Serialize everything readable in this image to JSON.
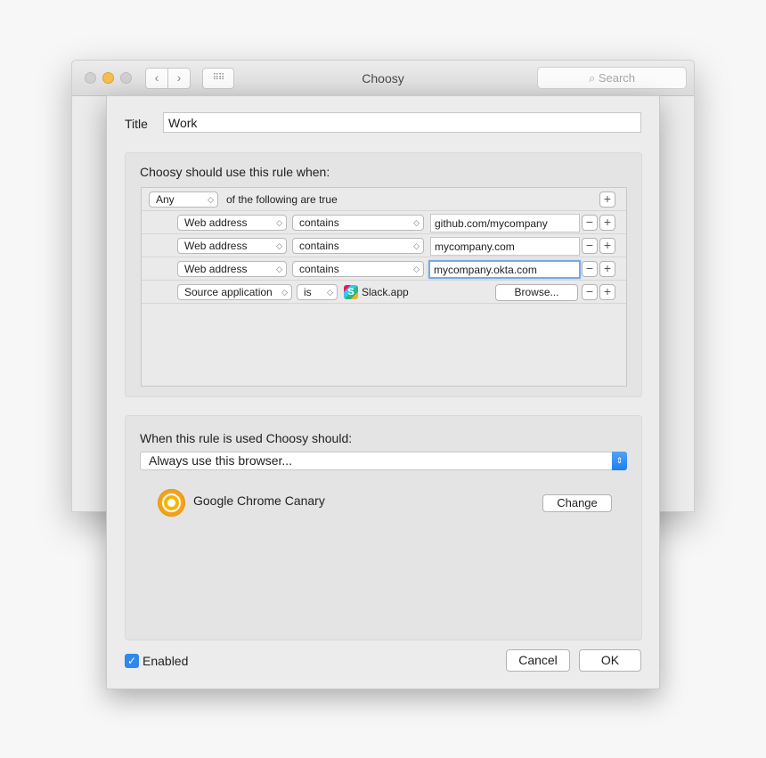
{
  "window": {
    "title": "Choosy",
    "search_placeholder": "Search",
    "back_glyph": "‹",
    "forward_glyph": "›",
    "grid_glyph": "⠿⠿"
  },
  "sheet": {
    "title_label": "Title",
    "title_value": "Work",
    "conditions": {
      "heading": "Choosy should use this rule when:",
      "match_mode": "Any",
      "match_suffix": "of the following are true",
      "add_glyph": "+",
      "remove_glyph": "−",
      "rules": [
        {
          "field": "Web address",
          "operator": "contains",
          "value": "github.com/mycompany"
        },
        {
          "field": "Web address",
          "operator": "contains",
          "value": "mycompany.com"
        },
        {
          "field": "Web address",
          "operator": "contains",
          "value": "mycompany.okta.com"
        },
        {
          "field": "Source application",
          "operator": "is",
          "value": "Slack.app",
          "browse_label": "Browse..."
        }
      ]
    },
    "action": {
      "heading": "When this rule is used Choosy should:",
      "selected_option": "Always use this browser...",
      "browser_name": "Google Chrome Canary",
      "change_label": "Change"
    },
    "enabled_label": "Enabled",
    "enabled_checked": true,
    "cancel_label": "Cancel",
    "ok_label": "OK"
  },
  "colors": {
    "accent": "#2f88ee",
    "focus_ring": "#7aa9e8",
    "minimize_yellow": "#f6be4f"
  },
  "icons": {
    "slack": "slack-app-icon",
    "chrome_canary": "chrome-canary-icon",
    "search": "search-icon",
    "checkbox": "checkmark-icon"
  }
}
